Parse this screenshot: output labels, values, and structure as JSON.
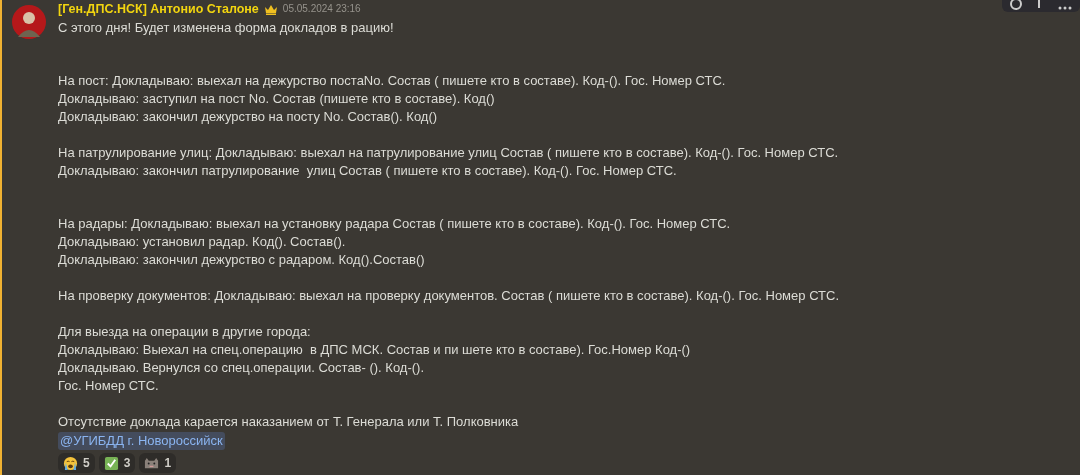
{
  "message": {
    "author": "[Ген.ДПС.НСК] Антонио Сталоне",
    "timestamp": "05.05.2024 23:16",
    "highlighted": true,
    "paragraphs": [
      {
        "kind": "opening",
        "lines": [
          "С этого дня! Будет изменена форма докладов в рацию!"
        ]
      },
      {
        "kind": "spaced",
        "lines": [
          "На пост: Докладываю: выехал на дежурство постаNo. Состав ( пишете кто в составе). Код-(). Гос. Номер СТС.",
          "Докладываю: заступил на пост No. Состав (пишете кто в составе). Код()",
          "Докладываю: закончил дежурство на посту No. Состав(). Код()"
        ]
      },
      {
        "kind": "block",
        "lines": [
          "На патрулирование улиц: Докладываю: выехал на патрулирование улиц Состав ( пишете кто в составе). Код-(). Гос. Номер СТС.",
          "Докладываю: закончил патрулирование  улиц Состав ( пишете кто в составе). Код-(). Гос. Номер СТС."
        ]
      },
      {
        "kind": "spaced",
        "lines": [
          "На радары: Докладываю: выехал на установку радара Состав ( пишете кто в составе). Код-(). Гос. Номер СТС.",
          "Докладываю: установил радар. Код(). Состав().",
          "Докладываю: закончил дежурство с радаром. Код().Состав()"
        ]
      },
      {
        "kind": "block",
        "lines": [
          "На проверку документов: Докладываю: выехал на проверку документов. Состав ( пишете кто в составе). Код-(). Гос. Номер СТС."
        ]
      },
      {
        "kind": "block",
        "lines": [
          "Для выезда на операции в другие города:",
          "Докладываю: Выехал на спец.операцию  в ДПС МСК. Состав и пи шете кто в составе). Гос.Номер Код-()",
          "Докладываю. Вернулся со спец.операции. Состав- (). Код-().",
          "Гос. Номер СТС."
        ]
      },
      {
        "kind": "block",
        "lines": [
          "Отсутствие доклада карается наказанием от Т. Генерала или Т. Полковника"
        ]
      }
    ],
    "mention": "@УГИБДД г. Новороссийск",
    "reactions": [
      {
        "kind": "crying",
        "count": "5"
      },
      {
        "kind": "check",
        "count": "3"
      },
      {
        "kind": "cat",
        "count": "1"
      }
    ]
  }
}
